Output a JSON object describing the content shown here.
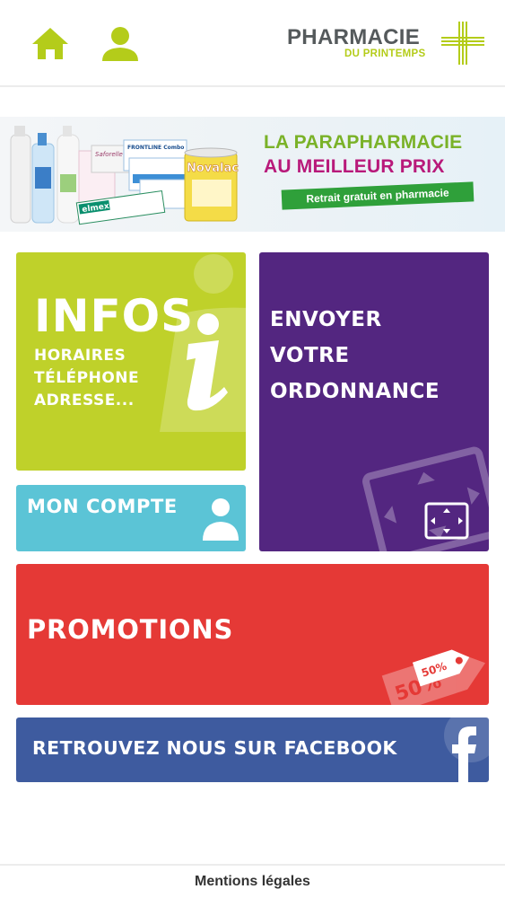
{
  "header": {
    "home_icon": "home-icon",
    "user_icon": "user-icon",
    "logo_line1": "PHARMACIE",
    "logo_line2": "DU PRINTEMPS",
    "accent_color": "#b4cc1a"
  },
  "banner": {
    "headline_line1": "LA PARAPHARMACIE",
    "headline_line2": "AU MEILLEUR PRIX",
    "pill_text": "Retrait gratuit en pharmacie",
    "product_labels": [
      "elmex",
      "Novalac",
      "FRONTLINE Combo",
      "Saforelle"
    ]
  },
  "tiles": {
    "infos": {
      "title": "INFOS",
      "line1": "HORAIRES",
      "line2": "TÉLÉPHONE",
      "line3": "ADRESSE...",
      "color": "#bfd12a",
      "icon": "info-icon"
    },
    "ordonnance": {
      "line1": "ENVOYER",
      "line2": "VOTRE",
      "line3": "ORDONNANCE",
      "color": "#532680",
      "icon": "scan-icon"
    },
    "compte": {
      "label": "MON COMPTE",
      "color": "#5bc4d6",
      "icon": "user-icon"
    },
    "promotions": {
      "label": "PROMOTIONS",
      "color": "#e53936",
      "icon": "price-tag-icon",
      "tag_big": "50%",
      "tag_small": "50%"
    },
    "facebook": {
      "label": "RETROUVEZ NOUS SUR FACEBOOK",
      "color": "#3e5b9f",
      "icon": "facebook-icon"
    }
  },
  "footer": {
    "link": "Mentions légales"
  }
}
